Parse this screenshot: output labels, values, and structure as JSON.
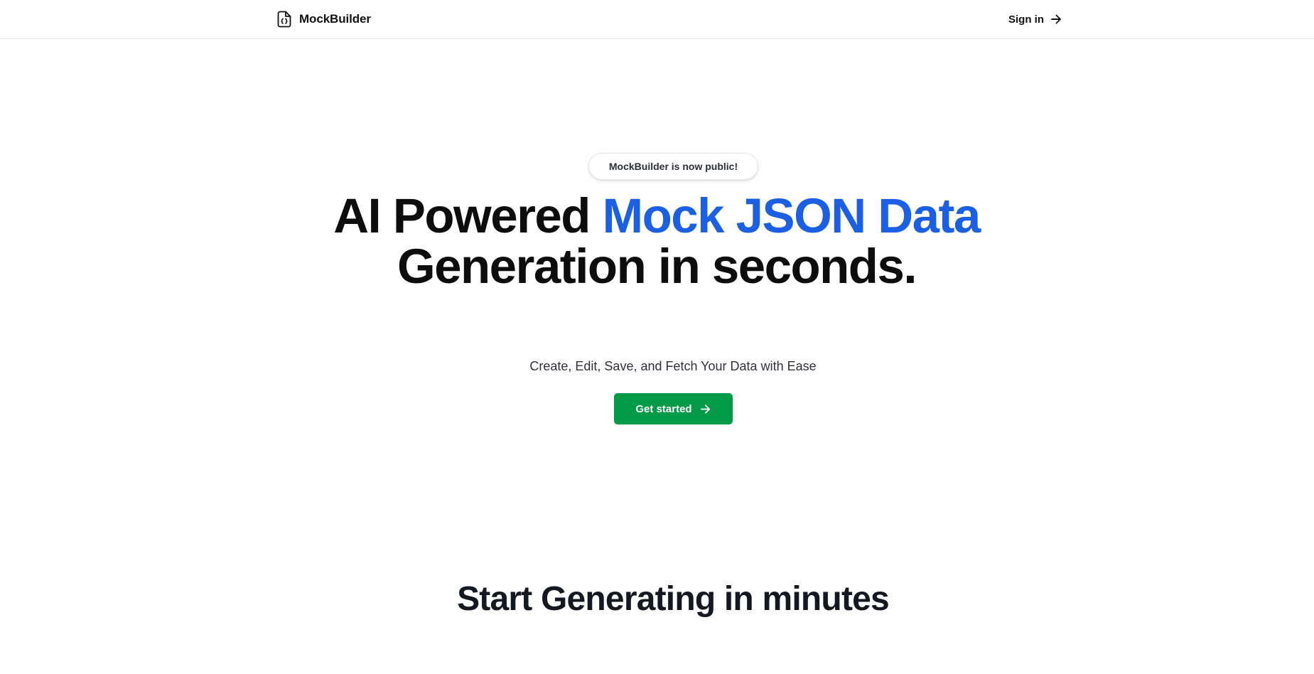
{
  "nav": {
    "brand_name": "MockBuilder",
    "brand_icon": "file-json-icon",
    "signin_label": "Sign in",
    "signin_icon": "arrow-right-icon"
  },
  "hero": {
    "badge_text": "MockBuilder is now public!",
    "title_part1": "AI Powered ",
    "title_highlight": "Mock JSON Data",
    "title_part2": " Generation in seconds.",
    "subtitle": "Create, Edit, Save, and Fetch Your Data with Ease",
    "cta_label": "Get started",
    "cta_icon": "arrow-right-icon"
  },
  "section": {
    "title": "Start Generating in minutes"
  },
  "colors": {
    "accent_blue": "#1b5fe3",
    "cta_green": "#049b48",
    "text_dark": "#0d0d0d",
    "border": "#e5e7eb"
  }
}
